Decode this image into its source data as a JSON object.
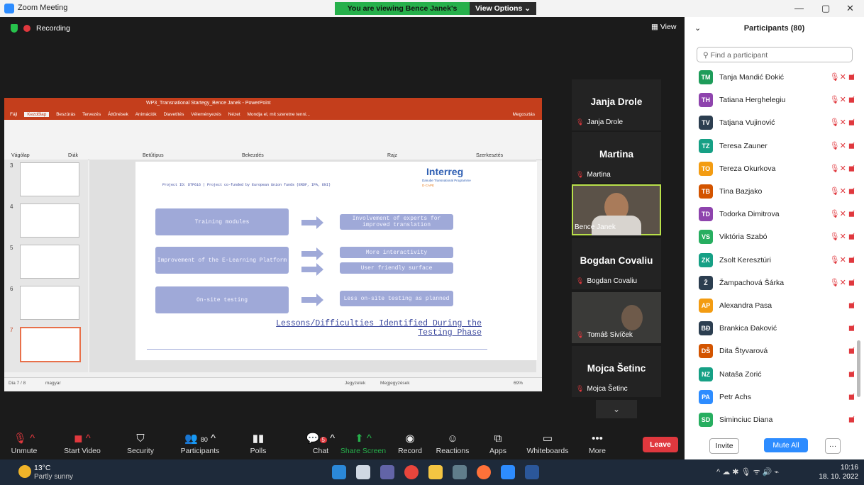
{
  "window": {
    "title": "Zoom Meeting",
    "viewing_banner": "You are viewing Bence Janek's screen",
    "view_options": "View Options",
    "min": "—",
    "max": "▢",
    "close": "✕"
  },
  "meeting": {
    "recording": "Recording",
    "view": "View"
  },
  "ppt": {
    "title": "WP3_Transnational Startegy_Bence Janek - PowerPoint",
    "tabs": [
      "Fájl",
      "Kezdőlap",
      "Beszúrás",
      "Tervezés",
      "Áttűnések",
      "Animációk",
      "Diavetítés",
      "Véleményezés",
      "Nézet",
      "Mondja el, mit szeretne tenni..."
    ],
    "share": "Megosztás",
    "ribbon_groups": [
      "Vágólap",
      "Diák",
      "Betűtípus",
      "Bekezdés",
      "Rajz",
      "Szerkesztés"
    ],
    "thumb_numbers": [
      "3",
      "4",
      "5",
      "6",
      "7"
    ],
    "slide": {
      "header_text": "Project ID: DTP616 | Project co-funded by European Union funds (ERDF, IPA, ENI)",
      "logo": "Interreg",
      "logo_sub": "Danube Transnational Programme",
      "logo_sub2": "D-CAPE",
      "boxes": [
        {
          "left": "Training modules",
          "right": [
            "Involvement of experts for improved translation"
          ]
        },
        {
          "left": "Improvement of the E-Learning Platform",
          "right": [
            "More interactivity",
            "User friendly surface"
          ]
        },
        {
          "left": "On-site testing",
          "right": [
            "Less on-site testing as planned"
          ]
        }
      ],
      "footer_title": "Lessons/Difficulties Identified During the Testing Phase"
    },
    "status_left": "Dia 7 / 8",
    "status_lang": "magyar",
    "status_notes": "Jegyzetek",
    "status_comments": "Megjegyzések",
    "zoom": "69%"
  },
  "tiles": [
    {
      "name": "Janja Drole",
      "label": "Janja Drole",
      "video": false
    },
    {
      "name": "Martina",
      "label": "Martina",
      "video": false
    },
    {
      "name": "",
      "label": "Bence Janek",
      "video": true
    },
    {
      "name": "Bogdan Covaliu",
      "label": "Bogdan Covaliu",
      "video": false
    },
    {
      "name": "",
      "label": "Tomáš Sivíček",
      "video": true
    },
    {
      "name": "Mojca Šetinc",
      "label": "Mojca Šetinc",
      "video": false
    }
  ],
  "toolbar": {
    "unmute": "Unmute",
    "start_video": "Start Video",
    "security": "Security",
    "participants": "Participants",
    "participants_count": "80",
    "polls": "Polls",
    "chat": "Chat",
    "chat_badge": "5",
    "share": "Share Screen",
    "record": "Record",
    "reactions": "Reactions",
    "apps": "Apps",
    "whiteboards": "Whiteboards",
    "more": "More",
    "leave": "Leave"
  },
  "panel": {
    "title": "Participants (80)",
    "search_placeholder": "Find a participant",
    "participants": [
      {
        "initials": "TM",
        "name": "Tanja Mandić Đokić",
        "color": "#1e9c5a",
        "mic": true
      },
      {
        "initials": "TH",
        "name": "Tatiana Herghelegiu",
        "color": "#8e44ad",
        "mic": true
      },
      {
        "initials": "TV",
        "name": "Tatjana Vujinović",
        "color": "#2c3e50",
        "mic": true
      },
      {
        "initials": "TZ",
        "name": "Teresa Zauner",
        "color": "#16a085",
        "mic": true
      },
      {
        "initials": "TO",
        "name": "Tereza Okurkova",
        "color": "#f39c12",
        "mic": true
      },
      {
        "initials": "TB",
        "name": "Tina Bazjako",
        "color": "#d35400",
        "mic": true
      },
      {
        "initials": "TD",
        "name": "Todorka Dimitrova",
        "color": "#8e44ad",
        "mic": true
      },
      {
        "initials": "VS",
        "name": "Viktória Szabó",
        "color": "#27ae60",
        "mic": true
      },
      {
        "initials": "ZK",
        "name": "Zsolt Keresztúri",
        "color": "#16a085",
        "mic": true
      },
      {
        "initials": "Ž",
        "name": "Žampachová Šárka",
        "color": "#2c3e50",
        "mic": true
      },
      {
        "initials": "AP",
        "name": "Alexandra Pasa",
        "color": "#f39c12",
        "mic": false
      },
      {
        "initials": "BĐ",
        "name": "Brankica Đaković",
        "color": "#2c3e50",
        "mic": false
      },
      {
        "initials": "DŠ",
        "name": "Dita Štyvarová",
        "color": "#d35400",
        "mic": false
      },
      {
        "initials": "NZ",
        "name": "Nataša Zorić",
        "color": "#16a085",
        "mic": false
      },
      {
        "initials": "PA",
        "name": "Petr Achs",
        "color": "#2d8cff",
        "mic": false
      },
      {
        "initials": "SD",
        "name": "Siminciuc Diana",
        "color": "#27ae60",
        "mic": false
      }
    ],
    "invite": "Invite",
    "mute_all": "Mute All",
    "more": "···"
  },
  "taskbar": {
    "temp": "13°C",
    "weather": "Partly sunny",
    "time": "10:16",
    "date": "18. 10. 2022"
  }
}
